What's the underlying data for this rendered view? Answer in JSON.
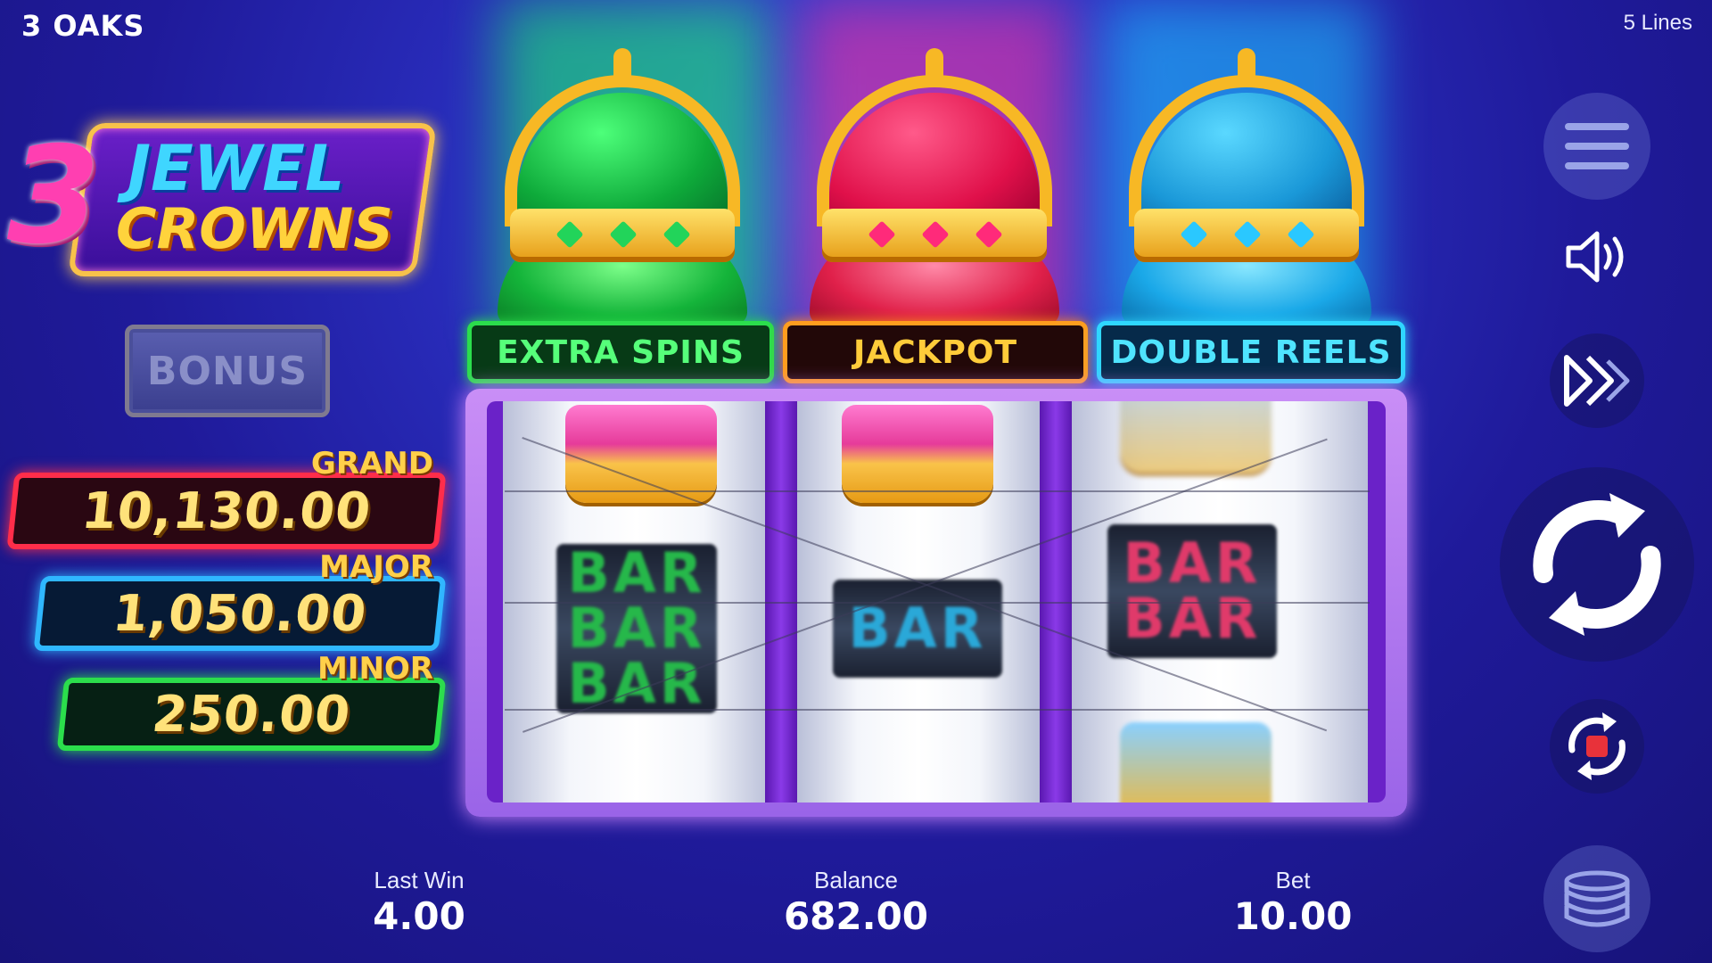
{
  "header": {
    "brand": "3 OAKS",
    "lines": "5 Lines"
  },
  "logo": {
    "number": "3",
    "line1": "JEWEL",
    "line2": "CROWNS"
  },
  "bonus": {
    "label": "BONUS"
  },
  "jackpots": {
    "grand": {
      "label": "GRAND",
      "value": "10,130.00"
    },
    "major": {
      "label": "MAJOR",
      "value": "1,050.00"
    },
    "minor": {
      "label": "MINOR",
      "value": "250.00"
    }
  },
  "features": {
    "extra_spins": "EXTRA SPINS",
    "jackpot": "JACKPOT",
    "double_reels": "DOUBLE REELS"
  },
  "reels": {
    "left_symbol": "BAR",
    "middle_symbol": "BAR",
    "right_symbol": "BAR"
  },
  "controls": {
    "menu_icon": "hamburger-menu-icon",
    "sound_icon": "speaker-icon",
    "turbo_icon": "fast-forward-icon",
    "spin_icon": "refresh-arrows-icon",
    "autoplay_icon": "autoplay-stop-icon",
    "bet_icon": "coin-stack-icon"
  },
  "stats": {
    "last_win": {
      "label": "Last Win",
      "value": "4.00"
    },
    "balance": {
      "label": "Balance",
      "value": "682.00"
    },
    "bet": {
      "label": "Bet",
      "value": "10.00"
    }
  },
  "colors": {
    "background": "#1f1a9a",
    "green": "#2bde4c",
    "red": "#ff2d4a",
    "blue": "#2fb7ff",
    "gold": "#ffd04a",
    "purple_frame": "#9a64e8"
  }
}
